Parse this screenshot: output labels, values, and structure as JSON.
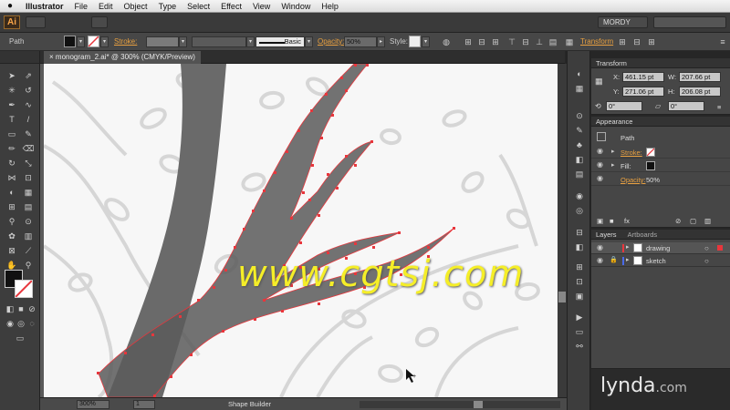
{
  "menubar": {
    "apple": "",
    "app_name": "Illustrator",
    "items": [
      "File",
      "Edit",
      "Object",
      "Type",
      "Select",
      "Effect",
      "View",
      "Window",
      "Help"
    ]
  },
  "appbar": {
    "logo": "Ai",
    "workspace": "MORDY",
    "accent_color": "#f7a54a"
  },
  "controlbar": {
    "selection_type": "Path",
    "stroke_label": "Stroke:",
    "brush_label": "Basic",
    "opacity_label": "Opacity:",
    "opacity_value": "50%",
    "style_label": "Style:",
    "transform_label": "Transform"
  },
  "document": {
    "tab_title": "monogram_2.ai* @ 300% (CMYK/Preview)",
    "zoom": "300%",
    "artboard": "1",
    "status_tool": "Shape Builder"
  },
  "transform_panel": {
    "title": "Transform",
    "x_label": "X:",
    "x": "461.15 pt",
    "y_label": "Y:",
    "y": "271.06 pt",
    "w_label": "W:",
    "w": "207.66 pt",
    "h_label": "H:",
    "h": "206.08 pt",
    "rotate": "0°",
    "shear": "0°"
  },
  "appearance_panel": {
    "title": "Appearance",
    "object_label": "Path",
    "stroke_label": "Stroke:",
    "fill_label": "Fill:",
    "opacity_label": "Opacity:",
    "opacity_value": "50%"
  },
  "layers_panel": {
    "tabs": [
      "Layers",
      "Artboards"
    ],
    "layers": [
      {
        "name": "drawing",
        "color": "#e8363c"
      },
      {
        "name": "sketch",
        "color": "#4a6ae8"
      }
    ]
  },
  "watermarks": {
    "site": "www.cgtsj.com",
    "brand": "lynda",
    "brand_domain": ".com"
  },
  "path_color": "#e8363c"
}
